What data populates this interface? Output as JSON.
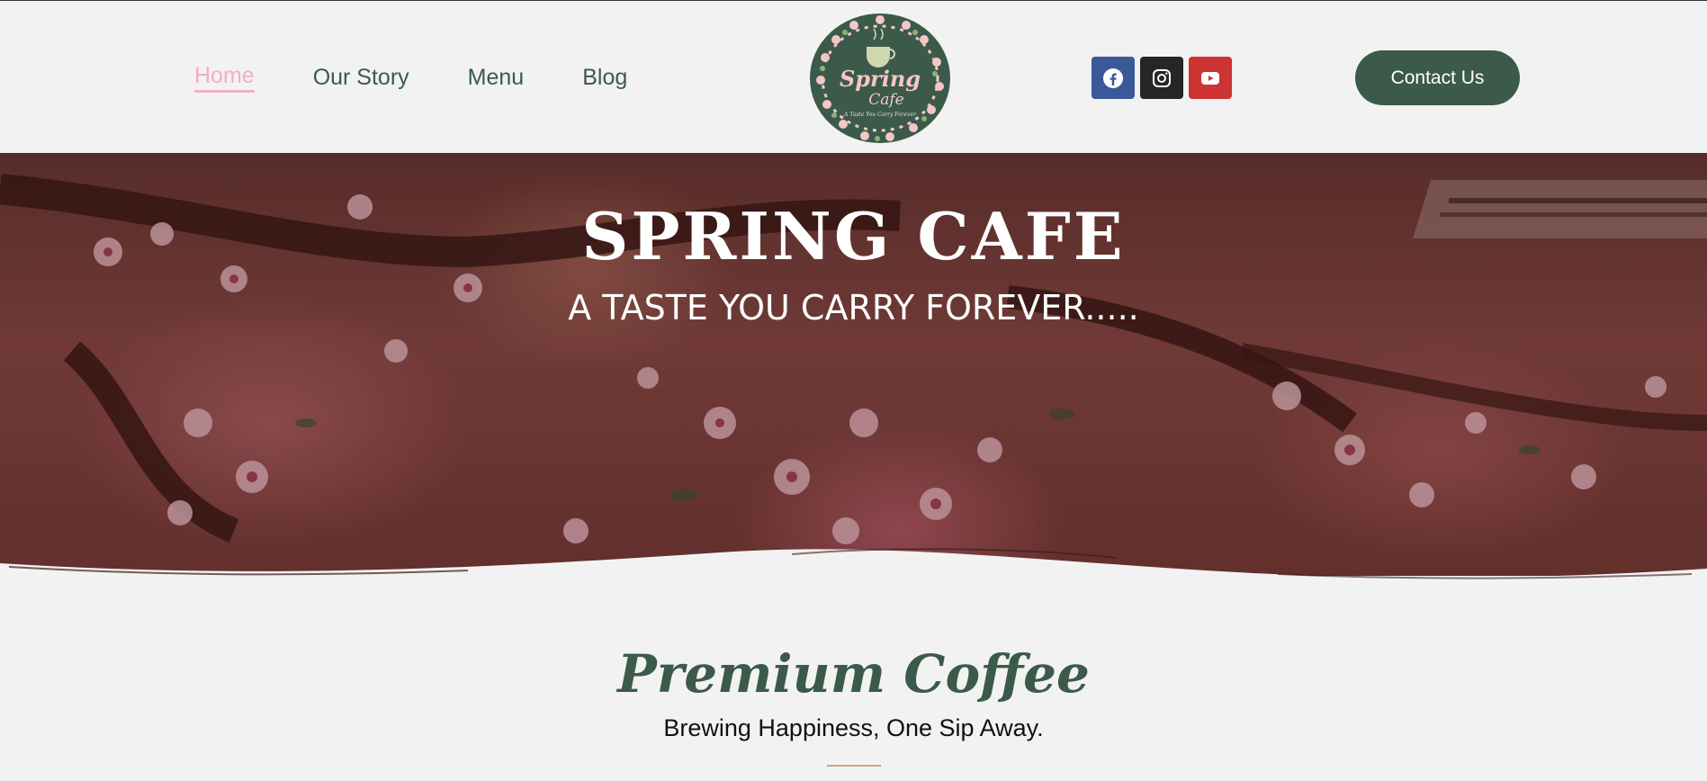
{
  "nav": {
    "items": [
      {
        "label": "Home",
        "active": true
      },
      {
        "label": "Our Story",
        "active": false
      },
      {
        "label": "Menu",
        "active": false
      },
      {
        "label": "Blog",
        "active": false
      }
    ]
  },
  "logo": {
    "title": "Spring",
    "subtitle": "Cafe",
    "tagline": "A Taste You Carry Forever"
  },
  "social": [
    {
      "name": "facebook-icon",
      "color": "#3b5998"
    },
    {
      "name": "instagram-icon",
      "color": "#262626"
    },
    {
      "name": "youtube-icon",
      "color": "#cd3333"
    }
  ],
  "header": {
    "contact_label": "Contact Us"
  },
  "hero": {
    "title": "SPRING CAFE",
    "subtitle": "A TASTE YOU CARRY FOREVER....."
  },
  "section": {
    "title": "Premium Coffee",
    "subtitle": "Brewing Happiness, One Sip Away."
  },
  "colors": {
    "brand_green": "#3b5a4a",
    "accent_pink": "#f2aec8",
    "gold": "#c9a77c"
  }
}
